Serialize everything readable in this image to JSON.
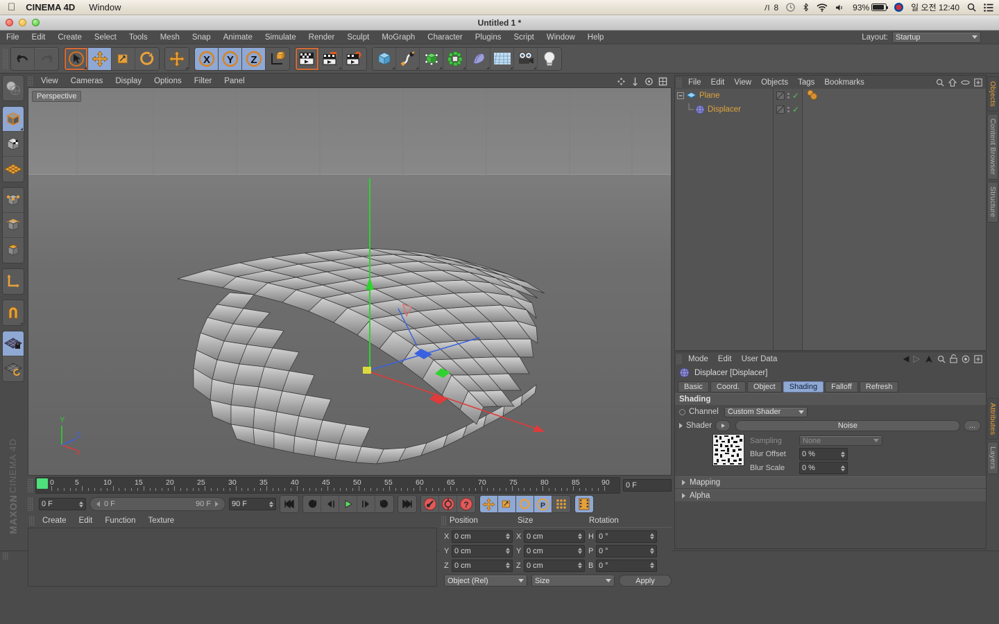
{
  "os_menubar": {
    "apple_icon": "apple-icon",
    "app_name": "CINEMA 4D",
    "menus": [
      "Window"
    ],
    "status": {
      "app_badge": "8",
      "time_machine_icon": "clock-icon",
      "bluetooth_icon": "bluetooth-icon",
      "wifi_icon": "wifi-icon",
      "volume_icon": "volume-icon",
      "battery_percent": "93%",
      "input_flag": "korean-flag-icon",
      "clock": "일 오전 12:40",
      "spotlight_icon": "search-icon",
      "notification_icon": "list-icon"
    }
  },
  "window": {
    "title": "Untitled 1 *"
  },
  "menubar": {
    "items": [
      "File",
      "Edit",
      "Create",
      "Select",
      "Tools",
      "Mesh",
      "Snap",
      "Animate",
      "Simulate",
      "Render",
      "Sculpt",
      "MoGraph",
      "Character",
      "Plugins",
      "Script",
      "Window",
      "Help"
    ],
    "layout_label": "Layout:",
    "layout_value": "Startup"
  },
  "toolbar": {
    "groups": [
      {
        "buttons": [
          {
            "name": "undo-button",
            "icon": "undo-icon",
            "state": "normal"
          },
          {
            "name": "redo-button",
            "icon": "redo-icon",
            "state": "disabled"
          }
        ]
      },
      {
        "buttons": [
          {
            "name": "live-selection-tool",
            "icon": "cursor-circle-icon",
            "state": "outlined"
          },
          {
            "name": "move-tool",
            "icon": "move-arrows-icon",
            "state": "active"
          },
          {
            "name": "scale-tool",
            "icon": "scale-icon",
            "state": "normal"
          },
          {
            "name": "rotate-tool",
            "icon": "rotate-icon",
            "state": "normal"
          }
        ]
      },
      {
        "buttons": [
          {
            "name": "move-axis-tool",
            "icon": "move-arrows-icon",
            "state": "normal"
          }
        ]
      },
      {
        "buttons": [
          {
            "name": "lock-x-axis",
            "icon": "x-axis-icon",
            "state": "active",
            "label": "X"
          },
          {
            "name": "lock-y-axis",
            "icon": "y-axis-icon",
            "state": "active",
            "label": "Y"
          },
          {
            "name": "lock-z-axis",
            "icon": "z-axis-icon",
            "state": "active",
            "label": "Z"
          },
          {
            "name": "world-coordinate-system",
            "icon": "world-axis-icon",
            "state": "normal"
          }
        ]
      },
      {
        "buttons": [
          {
            "name": "render-view-button",
            "icon": "render-view-icon",
            "state": "outlined"
          },
          {
            "name": "render-region-button",
            "icon": "render-region-icon",
            "state": "normal"
          },
          {
            "name": "render-settings-button",
            "icon": "render-settings-icon",
            "state": "normal"
          }
        ]
      },
      {
        "buttons": [
          {
            "name": "add-primitive-button",
            "icon": "cube-icon",
            "state": "normal"
          },
          {
            "name": "add-spline-button",
            "icon": "spline-pen-icon",
            "state": "normal"
          },
          {
            "name": "add-generator-button",
            "icon": "generator-icon",
            "state": "normal"
          },
          {
            "name": "add-mograph-button",
            "icon": "mograph-cloner-icon",
            "state": "normal"
          },
          {
            "name": "add-deformer-button",
            "icon": "bend-deformer-icon",
            "state": "normal"
          },
          {
            "name": "add-scene-object-button",
            "icon": "floor-grid-icon",
            "state": "normal"
          },
          {
            "name": "add-camera-button",
            "icon": "camera-icon",
            "state": "normal"
          },
          {
            "name": "add-light-button",
            "icon": "light-bulb-icon",
            "state": "normal"
          }
        ]
      }
    ]
  },
  "left_toolbar": {
    "groups": [
      [
        {
          "name": "make-editable-button",
          "icon": "make-editable-icon",
          "state": "normal"
        }
      ],
      [
        {
          "name": "model-mode-button",
          "icon": "model-cube-icon",
          "state": "active"
        },
        {
          "name": "texture-mode-button",
          "icon": "texture-cube-icon",
          "state": "normal"
        },
        {
          "name": "workplane-mode-button",
          "icon": "workplane-grid-icon",
          "state": "normal"
        }
      ],
      [
        {
          "name": "points-mode-button",
          "icon": "points-cube-icon",
          "state": "normal"
        },
        {
          "name": "edges-mode-button",
          "icon": "edges-cube-icon",
          "state": "normal"
        },
        {
          "name": "polygons-mode-button",
          "icon": "polygons-cube-icon",
          "state": "normal"
        }
      ],
      [
        {
          "name": "object-axis-mode-button",
          "icon": "axis-l-icon",
          "state": "normal"
        }
      ],
      [
        {
          "name": "enable-snapping-button",
          "icon": "magnet-icon",
          "state": "normal"
        }
      ],
      [
        {
          "name": "lock-workplane-button",
          "icon": "workplane-lock-icon",
          "state": "active"
        },
        {
          "name": "planar-workplane-button",
          "icon": "workplane-rotate-icon",
          "state": "normal"
        }
      ]
    ],
    "brand_bold": "MAXON",
    "brand_thin": "CINEMA 4D"
  },
  "viewport": {
    "menus": [
      "View",
      "Cameras",
      "Display",
      "Options",
      "Filter",
      "Panel"
    ],
    "label": "Perspective",
    "corner_icons": [
      "pan-icon",
      "zoom-icon",
      "rotate-icon",
      "maximize-icon"
    ],
    "axis_labels": {
      "x": "X",
      "y": "Y",
      "z": "Z"
    },
    "scene_description": "Displaced plane mesh wireframe with move gizmo"
  },
  "timeline": {
    "ticks": [
      "0",
      "5",
      "10",
      "15",
      "20",
      "25",
      "30",
      "35",
      "40",
      "45",
      "50",
      "55",
      "60",
      "65",
      "70",
      "75",
      "80",
      "85",
      "90"
    ],
    "current_frame_right": "0 F",
    "current_frame_field": "0 F",
    "range_start": "0 F",
    "range_end": "90 F",
    "end_frame_field": "90 F"
  },
  "transport": {
    "buttons": [
      {
        "name": "go-to-start-button",
        "icon": "skip-back-icon"
      },
      {
        "name": "previous-key-button",
        "icon": "prev-key-icon"
      },
      {
        "name": "step-back-button",
        "icon": "step-back-icon"
      },
      {
        "name": "play-button",
        "icon": "play-icon"
      },
      {
        "name": "step-forward-button",
        "icon": "step-forward-icon"
      },
      {
        "name": "next-key-button",
        "icon": "next-key-icon"
      },
      {
        "name": "go-to-end-button",
        "icon": "skip-forward-icon"
      },
      {
        "name": "record-keyframe-button",
        "icon": "record-key-icon"
      },
      {
        "name": "autokeying-button",
        "icon": "autokey-icon"
      },
      {
        "name": "keyframe-selection-button",
        "icon": "question-key-icon"
      },
      {
        "name": "position-key-button",
        "icon": "move-arrows-icon"
      },
      {
        "name": "scale-key-button",
        "icon": "scale-icon"
      },
      {
        "name": "rotation-key-button",
        "icon": "rotate-icon"
      },
      {
        "name": "parameter-key-button",
        "icon": "p-circle-icon"
      },
      {
        "name": "point-level-anim-button",
        "icon": "dots-grid-icon"
      },
      {
        "name": "timeline-button",
        "icon": "film-strip-icon"
      }
    ]
  },
  "material_manager": {
    "menus": [
      "Create",
      "Edit",
      "Function",
      "Texture"
    ],
    "materials": []
  },
  "coordinates": {
    "headers": [
      "Position",
      "Size",
      "Rotation"
    ],
    "rows": [
      {
        "pos_label": "X",
        "pos_value": "0 cm",
        "size_label": "X",
        "size_value": "0 cm",
        "rot_label": "H",
        "rot_value": "0 °"
      },
      {
        "pos_label": "Y",
        "pos_value": "0 cm",
        "size_label": "Y",
        "size_value": "0 cm",
        "rot_label": "P",
        "rot_value": "0 °"
      },
      {
        "pos_label": "Z",
        "pos_value": "0 cm",
        "size_label": "Z",
        "size_value": "0 cm",
        "rot_label": "B",
        "rot_value": "0 °"
      }
    ],
    "coord_system": "Object (Rel)",
    "size_mode": "Size",
    "apply_label": "Apply"
  },
  "object_manager": {
    "menus": [
      "File",
      "Edit",
      "View",
      "Objects",
      "Tags",
      "Bookmarks"
    ],
    "header_icons": [
      "search-icon",
      "home-icon",
      "ellipse-icon",
      "add-icon"
    ],
    "objects": [
      {
        "name": "Plane",
        "icon": "plane-object-icon",
        "depth": 0,
        "visible_editor": true,
        "visible_render": true,
        "has_tag": true
      },
      {
        "name": "Displacer",
        "icon": "displacer-object-icon",
        "depth": 1,
        "visible_editor": true,
        "visible_render": true,
        "has_tag": false
      }
    ],
    "tabs": [
      "Objects",
      "Content Browser",
      "Structure"
    ],
    "active_tab": "Objects"
  },
  "attribute_manager": {
    "menus": [
      "Mode",
      "Edit",
      "User Data"
    ],
    "header_icons": [
      "back-icon",
      "forward-icon",
      "up-icon",
      "search-icon",
      "lock-icon",
      "target-icon",
      "add-icon"
    ],
    "object_title": "Displacer [Displacer]",
    "object_icon": "displacer-object-icon",
    "tabs": [
      {
        "label": "Basic",
        "active": false
      },
      {
        "label": "Coord.",
        "active": false
      },
      {
        "label": "Object",
        "active": false
      },
      {
        "label": "Shading",
        "active": true
      },
      {
        "label": "Falloff",
        "active": false
      },
      {
        "label": "Refresh",
        "active": false
      }
    ],
    "section_title": "Shading",
    "channel_label": "Channel",
    "channel_value": "Custom Shader",
    "shader_label": "Shader",
    "shader_value": "Noise",
    "shader_more": "...",
    "sampling_label": "Sampling",
    "sampling_value": "None",
    "blur_offset_label": "Blur Offset",
    "blur_offset_value": "0 %",
    "blur_scale_label": "Blur Scale",
    "blur_scale_value": "0 %",
    "fold_sections": [
      "Mapping",
      "Alpha"
    ],
    "tabs_vertical": [
      "Attributes",
      "Layers"
    ],
    "active_tab_vertical": "Attributes"
  },
  "colors": {
    "accent_orange": "#e0a33c",
    "active_blue": "#8fa8d4",
    "panel_bg": "#4b4b4b",
    "viewport_bg": "#6a6a6a",
    "green_marker": "#4ee07a"
  }
}
